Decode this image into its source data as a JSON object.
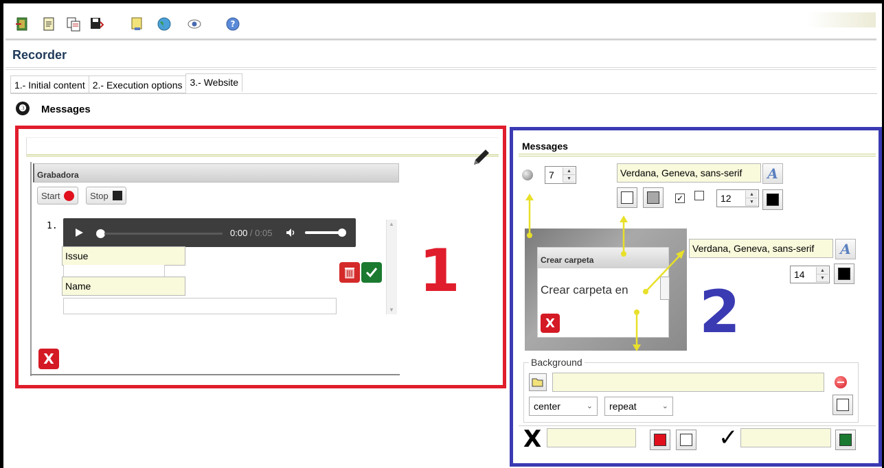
{
  "toolbar": {
    "icons": [
      "exit-icon",
      "document-icon",
      "copy-icon",
      "save-icon",
      "notes-icon",
      "globe-icon",
      "preview-eye-icon",
      "help-icon"
    ]
  },
  "app": {
    "title": "Recorder"
  },
  "tabs": [
    {
      "label": "1.- Initial content"
    },
    {
      "label": "2.- Execution options"
    },
    {
      "label": "3.- Website",
      "active": true
    }
  ],
  "section": {
    "step": "❸",
    "title": "Messages"
  },
  "preview": {
    "header": "Grabadora",
    "start_label": "Start",
    "stop_label": "Stop",
    "item_number": "1.",
    "audio": {
      "current": "0:00",
      "separator": " / ",
      "duration": "0:05"
    },
    "issue_label": "Issue",
    "name_label": "Name",
    "close_label": "X",
    "annotation": "1"
  },
  "settings": {
    "title": "Messages",
    "border_radius": "7",
    "dialog_font": "Verdana, Geneva, sans-serif",
    "dialog_font_size": "12",
    "header_font": "Verdana, Geneva, sans-serif",
    "header_font_size": "14",
    "sample_dialog": {
      "title": "Crear carpeta",
      "body": "Crear carpeta en",
      "close": "X"
    },
    "annotation": "2",
    "background": {
      "legend": "Background",
      "image_path": "",
      "position": "center",
      "repeat": "repeat"
    },
    "cancel_symbol": "X",
    "cancel_text": "",
    "ok_symbol": "✓",
    "ok_text": ""
  },
  "colors": {
    "annotation_red": "#e01d2c",
    "annotation_blue": "#3a3ab3",
    "field_yellow": "#f9f9dc",
    "cancel_red": "#e0101c",
    "ok_green": "#1a7a30",
    "arrow_yellow": "#e8e02a"
  }
}
